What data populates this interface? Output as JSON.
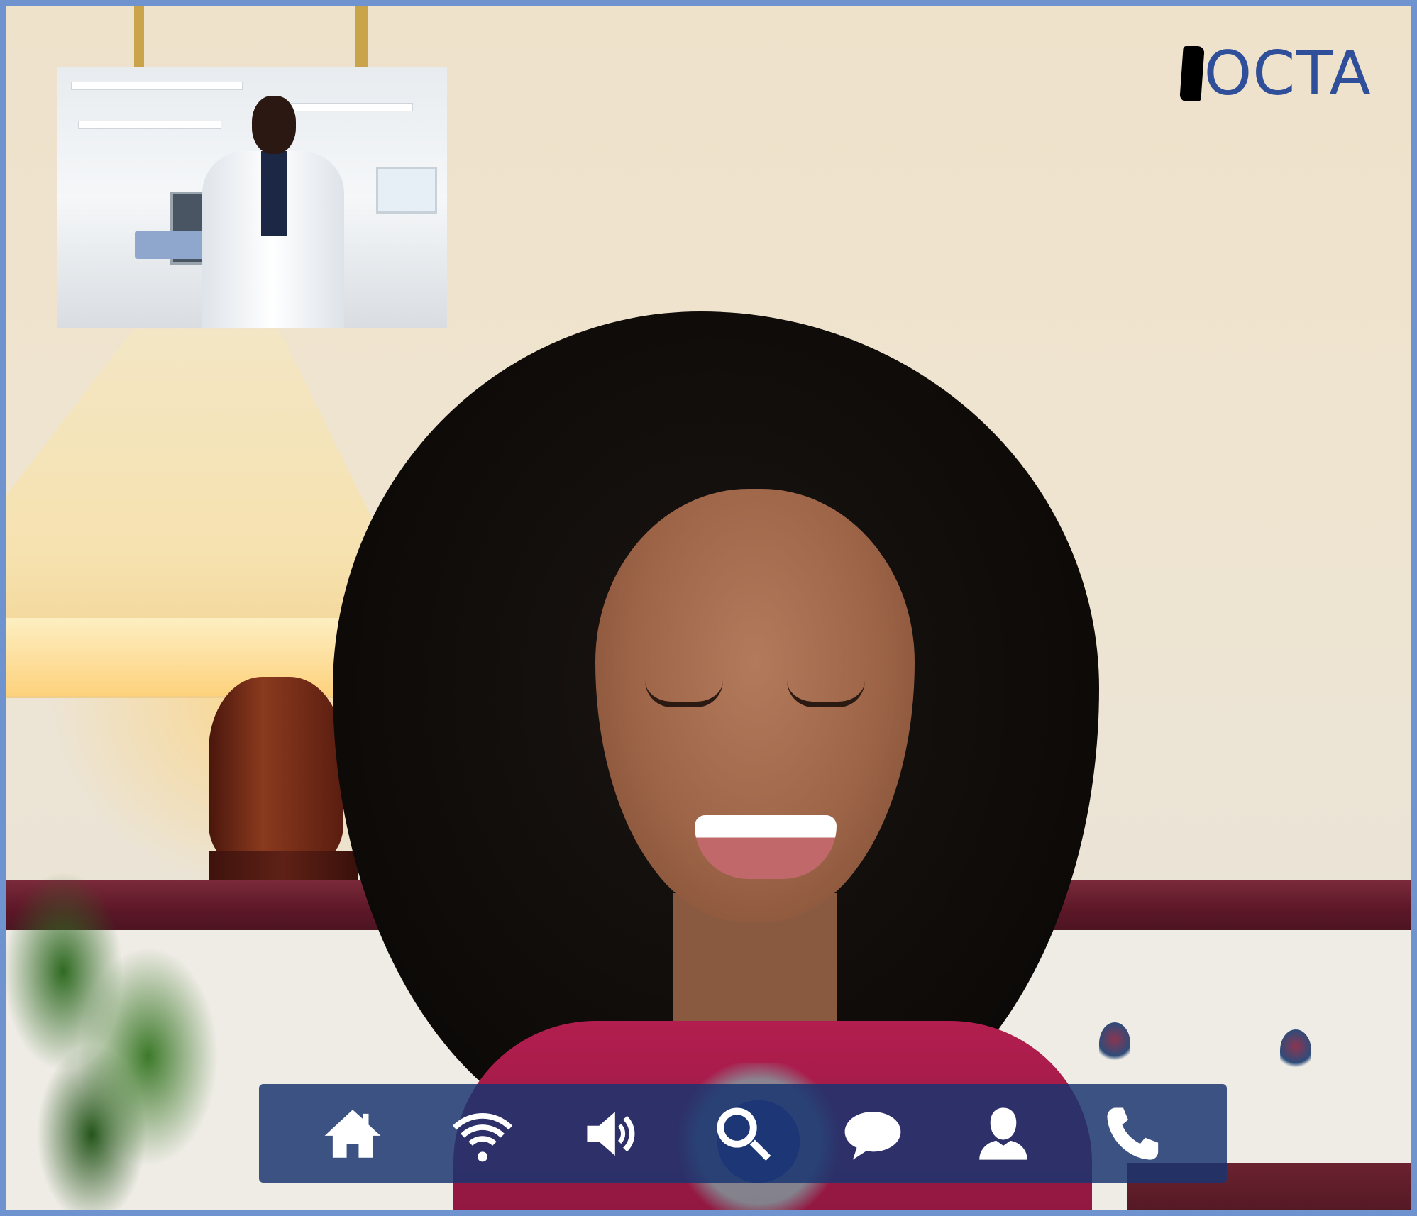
{
  "brand": {
    "logo_text": "OCTA",
    "color": "#2f4f9a"
  },
  "call": {
    "main_video": "remote-participant-video",
    "pip_video": "self-view-video"
  },
  "toolbar": {
    "background": "#183470",
    "buttons": [
      {
        "icon": "home-icon"
      },
      {
        "icon": "wifi-icon"
      },
      {
        "icon": "volume-icon"
      },
      {
        "icon": "search-icon"
      },
      {
        "icon": "chat-icon"
      },
      {
        "icon": "user-icon"
      },
      {
        "icon": "phone-icon"
      }
    ]
  },
  "frame": {
    "border_color": "#6f93cf"
  }
}
